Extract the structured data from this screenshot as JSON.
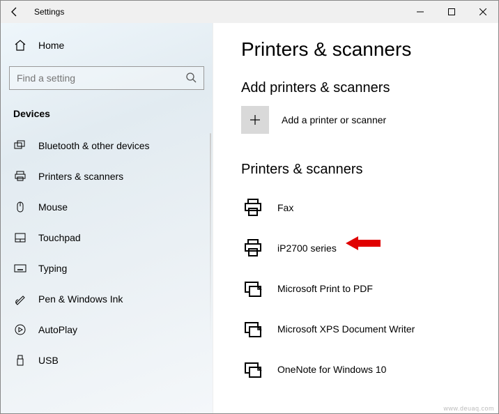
{
  "window": {
    "title": "Settings"
  },
  "sidebar": {
    "home_label": "Home",
    "search_placeholder": "Find a setting",
    "section_label": "Devices",
    "items": [
      {
        "label": "Bluetooth & other devices",
        "icon": "bluetooth-devices-icon"
      },
      {
        "label": "Printers & scanners",
        "icon": "printer-icon"
      },
      {
        "label": "Mouse",
        "icon": "mouse-icon"
      },
      {
        "label": "Touchpad",
        "icon": "touchpad-icon"
      },
      {
        "label": "Typing",
        "icon": "keyboard-icon"
      },
      {
        "label": "Pen & Windows Ink",
        "icon": "pen-icon"
      },
      {
        "label": "AutoPlay",
        "icon": "autoplay-icon"
      },
      {
        "label": "USB",
        "icon": "usb-icon"
      }
    ]
  },
  "main": {
    "page_title": "Printers & scanners",
    "add_section_title": "Add printers & scanners",
    "add_button_label": "Add a printer or scanner",
    "list_section_title": "Printers & scanners",
    "devices": [
      {
        "label": "Fax",
        "icon": "printer-icon"
      },
      {
        "label": "iP2700 series",
        "icon": "printer-icon"
      },
      {
        "label": "Microsoft Print to PDF",
        "icon": "print-to-file-icon"
      },
      {
        "label": "Microsoft XPS Document Writer",
        "icon": "print-to-file-icon"
      },
      {
        "label": "OneNote for Windows 10",
        "icon": "print-to-file-icon"
      }
    ]
  },
  "annotation": {
    "highlighted_device_index": 1
  },
  "watermark": "www.deuaq.com"
}
